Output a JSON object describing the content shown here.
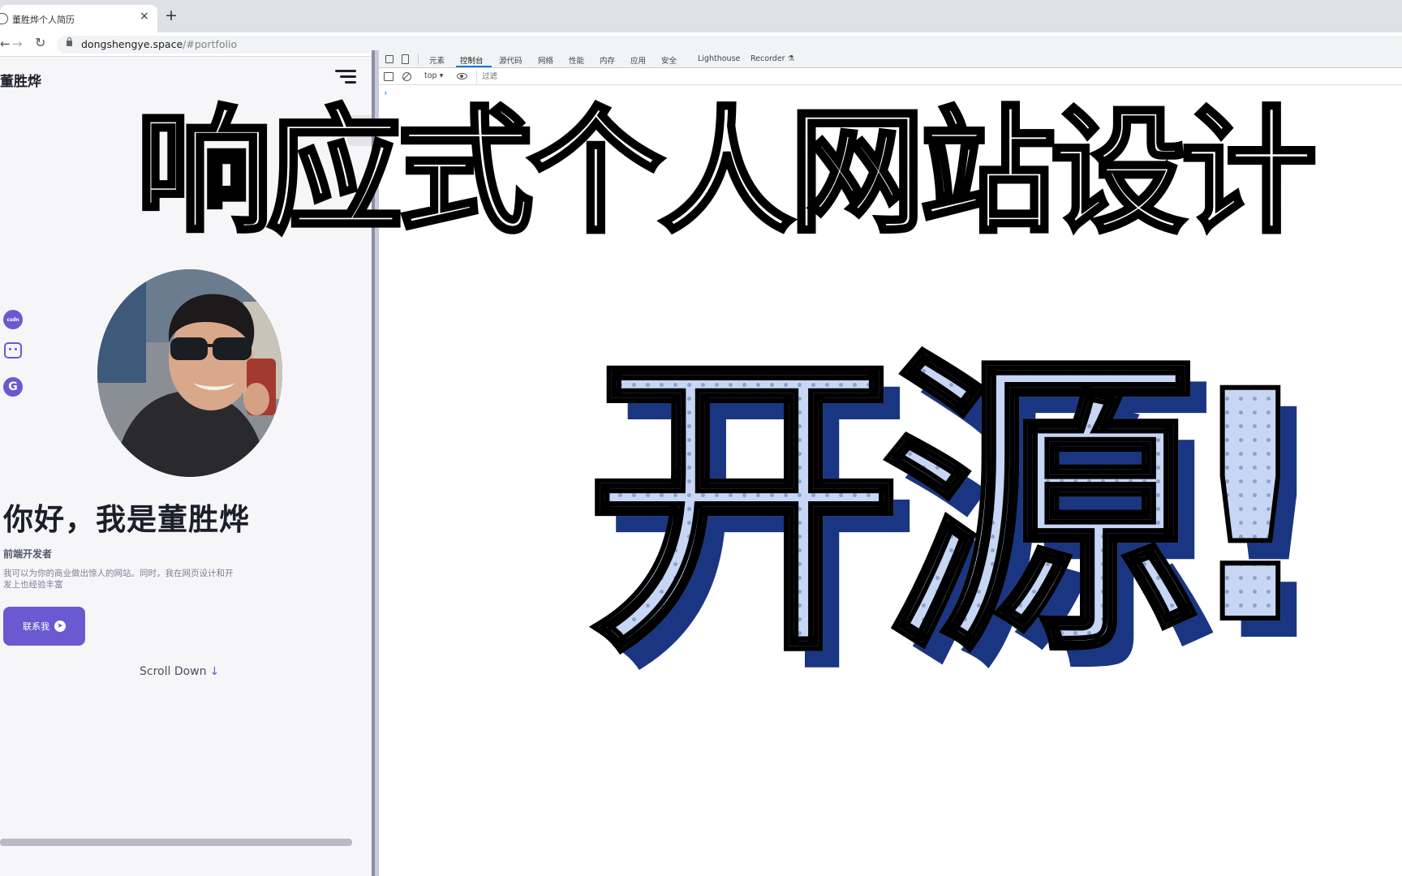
{
  "browser": {
    "tab_title": "董胜烨个人简历",
    "tab_close": "×",
    "new_tab": "+",
    "nav_back": "←",
    "nav_forward": "→",
    "nav_reload": "↻",
    "url_domain": "dongshengye.space",
    "url_path": "/#portfolio"
  },
  "site": {
    "logo": "董胜烨",
    "social": [
      {
        "name": "csdn",
        "label": "csdn"
      },
      {
        "name": "bilibili",
        "label": ""
      },
      {
        "name": "gitee",
        "label": "G"
      }
    ],
    "hero_title": "你好，我是董胜烨",
    "hero_subtitle": "前端开发者",
    "hero_desc": "我可以为你的商业做出惊人的网站。同时，我在网页设计和开发上也经验丰富",
    "contact_label": "联系我",
    "contact_icon": "➤",
    "scroll_label": "Scroll Down",
    "scroll_arrow": "↓",
    "theme_icon": "moon-icon"
  },
  "devtools": {
    "tabs": [
      "元素",
      "控制台",
      "源代码",
      "网络",
      "性能",
      "内存",
      "应用",
      "安全",
      "Lighthouse",
      "Recorder ⚗"
    ],
    "active_tab": "控制台",
    "context": "top ▾",
    "filter_placeholder": "过滤",
    "prompt": "›"
  },
  "overlay": {
    "banner": "响应式个人网站设计",
    "headline": "开源!"
  },
  "colors": {
    "accent": "#6a59d1",
    "headline_fill": "#c8d6f5",
    "headline_shadow": "#1a3682"
  }
}
